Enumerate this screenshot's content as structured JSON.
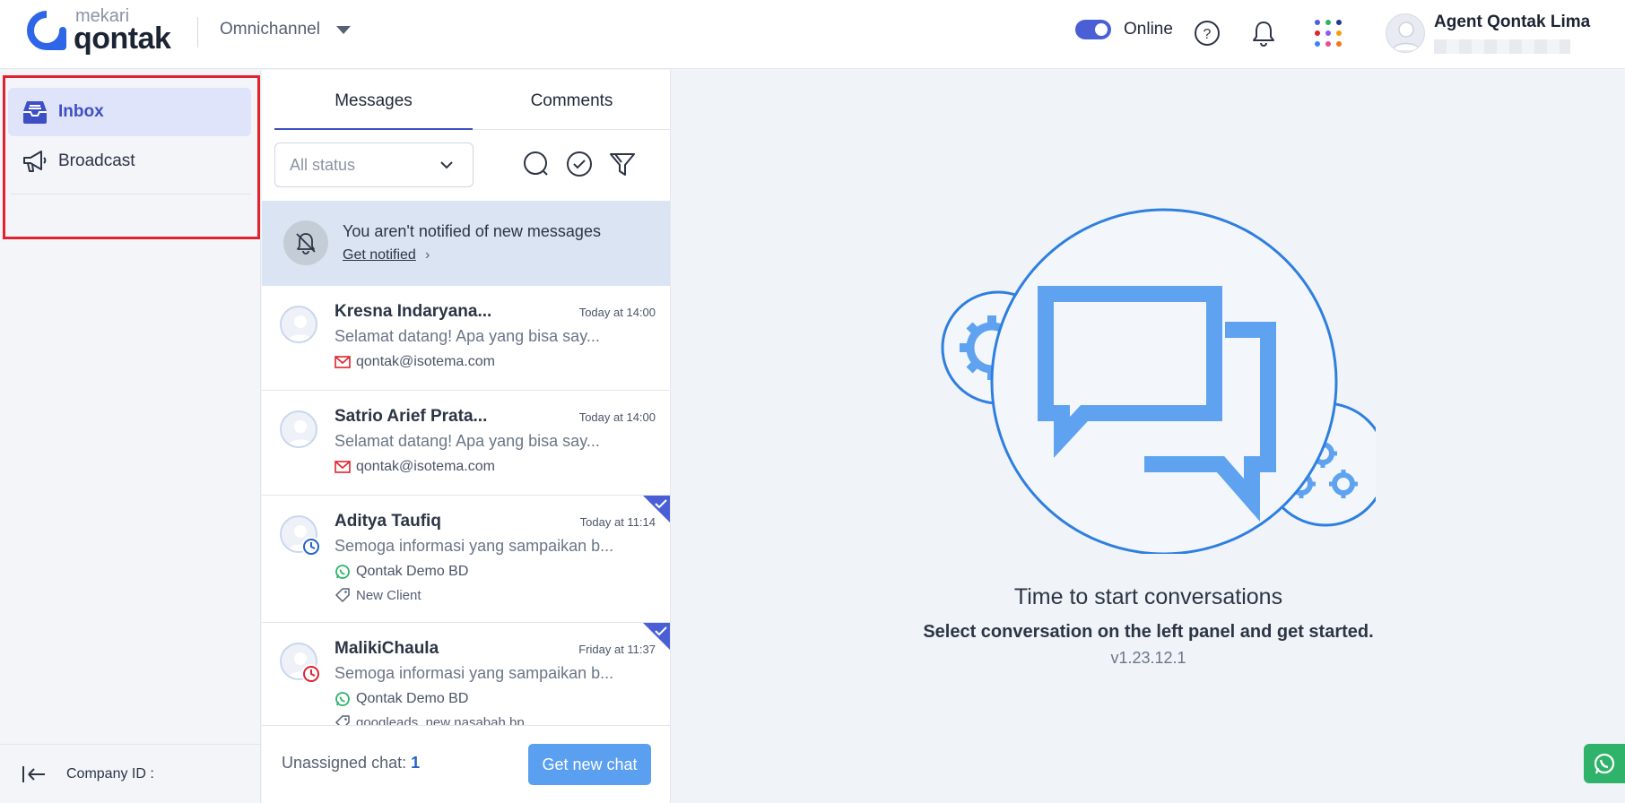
{
  "header": {
    "brand_small": "mekari",
    "brand_large": "qontak",
    "product": "Omnichannel",
    "status_label": "Online",
    "user_name": "Agent Qontak Lima"
  },
  "sidebar": {
    "items": [
      {
        "label": "Inbox",
        "icon": "inbox-icon"
      },
      {
        "label": "Broadcast",
        "icon": "megaphone-icon"
      }
    ],
    "company_id_label": "Company ID :"
  },
  "list": {
    "tabs": [
      {
        "label": "Messages"
      },
      {
        "label": "Comments"
      }
    ],
    "filter_value": "All status",
    "notification": {
      "title": "You aren't notified of new messages",
      "link": "Get notified"
    },
    "conversations": [
      {
        "name": "Kresna Indaryana...",
        "time": "Today at 14:00",
        "preview": "Selamat datang! Apa yang bisa say...",
        "channel": "qontak@isotema.com",
        "channel_icon": "mail-icon"
      },
      {
        "name": "Satrio Arief Prata...",
        "time": "Today at 14:00",
        "preview": "Selamat datang! Apa yang bisa say...",
        "channel": "qontak@isotema.com",
        "channel_icon": "mail-icon"
      },
      {
        "name": "Aditya Taufiq",
        "time": "Today at 11:14",
        "preview": "Semoga informasi yang sampaikan b...",
        "channel": "Qontak Demo BD",
        "channel_icon": "whatsapp-icon",
        "tag": "New Client"
      },
      {
        "name": "MalikiChaula",
        "time": "Friday at 11:37",
        "preview": "Semoga informasi yang sampaikan b...",
        "channel": "Qontak Demo BD",
        "channel_icon": "whatsapp-icon",
        "tag": "googleads_new nasabah bp"
      }
    ],
    "footer": {
      "unassigned_label": "Unassigned chat: ",
      "unassigned_count": "1",
      "button": "Get new chat"
    }
  },
  "main": {
    "title": "Time to start conversations",
    "subtitle": "Select conversation on the left panel and get started.",
    "version": "v1.23.12.1"
  },
  "colors": {
    "accent": "#4a5fd6",
    "button": "#5b9ff0",
    "illustration": "#5fa3f0",
    "highlight_box": "#e0232e"
  }
}
